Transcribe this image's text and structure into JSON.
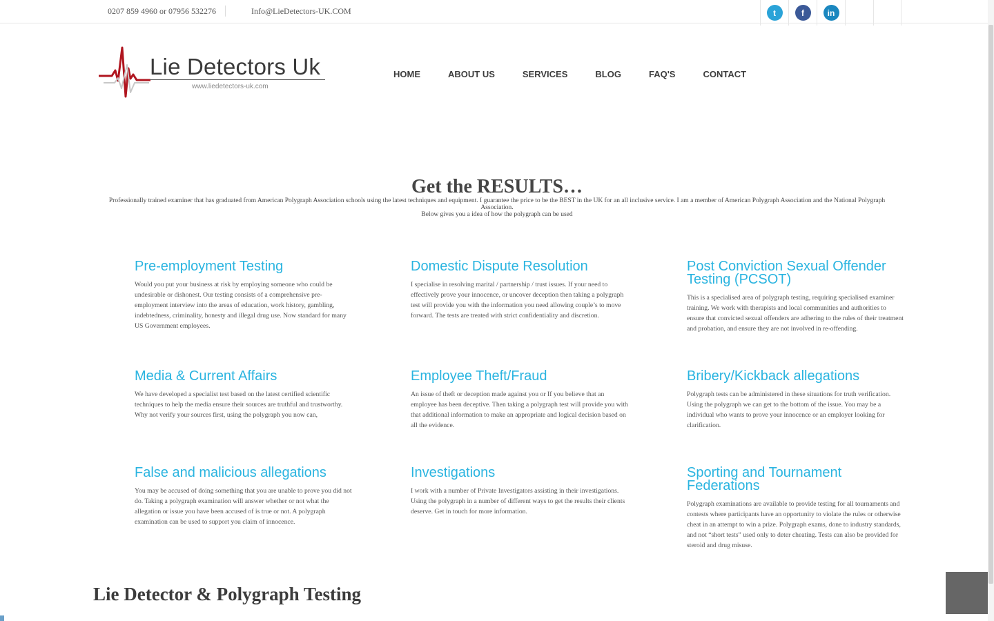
{
  "topbar": {
    "phone": "0207 859 4960 or 07956 532276",
    "email": "Info@LieDetectors-UK.COM",
    "social": [
      {
        "icon": "twitter-icon",
        "glyph": "t"
      },
      {
        "icon": "facebook-icon",
        "glyph": "f"
      },
      {
        "icon": "linkedin-icon",
        "glyph": "in"
      }
    ]
  },
  "logo": {
    "name": "Lie Detectors Uk",
    "url": "www.liedetectors-uk.com"
  },
  "nav": {
    "items": [
      "HOME",
      "ABOUT US",
      "SERVICES",
      "BLOG",
      "FAQ'S",
      "CONTACT"
    ]
  },
  "hero": {
    "title": "Get the RESULTS…",
    "text": "Professionally trained examiner that has graduated from American Polygraph Association schools using the latest techniques and equipment. I guarantee the price to be the BEST in the UK for an all inclusive service. I am a member of American Polygraph Association and the National Polygraph Association.",
    "subtext": "Below gives you a idea of how the polygraph can be used"
  },
  "services": [
    {
      "title": "Pre-employment Testing",
      "text": "Would you put your business at risk by employing someone who could be undesirable or dishonest. Our testing consists of a comprehensive pre-employment interview into the areas of education, work history, gambling, indebtedness, criminality, honesty and illegal drug use. Now standard for many US Government employees."
    },
    {
      "title": "Domestic Dispute Resolution",
      "text": "I specialise in resolving marital / partnership / trust issues. If your need to effectively prove your innocence, or uncover deception then taking a polygraph test will provide you with the information you need allowing couple’s to move forward. The tests are treated with strict confidentiality and discretion."
    },
    {
      "title": "Post Conviction Sexual Offender Testing (PCSOT)",
      "text": "This is a specialised area of polygraph testing, requiring specialised examiner training. We work with therapists and local communities and authorities to ensure that convicted sexual offenders are adhering to the rules of their treatment and probation, and ensure they are not involved in re-offending."
    },
    {
      "title": "Media & Current Affairs",
      "text": "We have developed a specialist test based on the latest certified scientific techniques to help the media ensure their sources are truthful and trustworthy. Why not verify your sources first, using the polygraph you now can,"
    },
    {
      "title": "Employee Theft/Fraud",
      "text": "An issue of theft or deception made against you or If you believe that an employee has been deceptive. Then taking a polygraph test will provide you with that additional information to make an appropriate and logical decision based on all the evidence."
    },
    {
      "title": "Bribery/Kickback allegations",
      "text": "Polygraph tests can be administered in these situations for truth verification. Using the polygraph we can get to the bottom of the issue. You may be a individual who wants to prove your innocence or an employer looking for clarification."
    },
    {
      "title": "False and malicious allegations",
      "text": "You may be accused of doing something that you are unable to prove you did not do. Taking a polygraph examination will answer whether or not what the allegation or issue you have been accused of is true or not. A polygraph examination can be used to support you claim of innocence."
    },
    {
      "title": "Investigations",
      "text": "I work with a number of Private Investigators assisting in their investigations. Using the polygraph in a number of different ways to get the results their clients deserve. Get in touch for more information."
    },
    {
      "title": "Sporting and Tournament Federations",
      "text": "Polygraph examinations are available to provide testing for all tournaments and contests where participants have an opportunity to violate the rules or otherwise cheat in an attempt to win a prize. Polygraph exams, done to industry standards, and not “short tests” used only to deter cheating. Tests can also be provided for steroid and drug misuse."
    }
  ],
  "section": {
    "title": "Lie Detector & Polygraph Testing"
  },
  "colors": {
    "accent": "#2ab4e0",
    "logo_pulse": "#b0151f",
    "text": "#444444"
  }
}
